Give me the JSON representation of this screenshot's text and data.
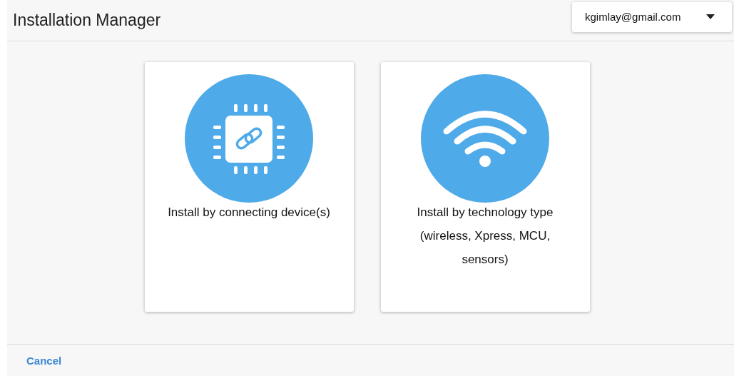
{
  "window": {
    "title": "Installation Manager"
  },
  "account": {
    "email": "kgimlay@gmail.com"
  },
  "options": [
    {
      "kind": "chip",
      "label": "Install by connecting device(s)"
    },
    {
      "kind": "wifi",
      "label": "Install by technology type (wireless, Xpress, MCU, sensors)"
    }
  ],
  "footer": {
    "cancel": "Cancel"
  }
}
